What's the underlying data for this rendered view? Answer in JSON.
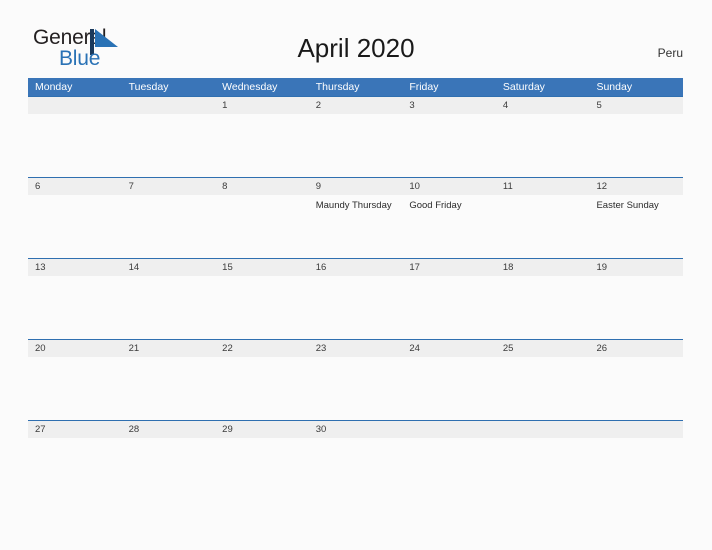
{
  "brand": {
    "name_part1": "General",
    "name_part2": "Blue",
    "mark": "triangle-flag-logo",
    "color_dark": "#231f20",
    "color_blue": "#2a72b5"
  },
  "header": {
    "title": "April 2020",
    "country": "Peru"
  },
  "colors": {
    "header_blue": "#3a75b8",
    "date_band_gray": "#efefef",
    "row_border_blue": "#2f6fb0",
    "page_background": "#fbfbfb"
  },
  "calendar": {
    "weekdays": [
      "Monday",
      "Tuesday",
      "Wednesday",
      "Thursday",
      "Friday",
      "Saturday",
      "Sunday"
    ],
    "weeks": [
      [
        {
          "date": "",
          "event": ""
        },
        {
          "date": "",
          "event": ""
        },
        {
          "date": "1",
          "event": ""
        },
        {
          "date": "2",
          "event": ""
        },
        {
          "date": "3",
          "event": ""
        },
        {
          "date": "4",
          "event": ""
        },
        {
          "date": "5",
          "event": ""
        }
      ],
      [
        {
          "date": "6",
          "event": ""
        },
        {
          "date": "7",
          "event": ""
        },
        {
          "date": "8",
          "event": ""
        },
        {
          "date": "9",
          "event": "Maundy Thursday"
        },
        {
          "date": "10",
          "event": "Good Friday"
        },
        {
          "date": "11",
          "event": ""
        },
        {
          "date": "12",
          "event": "Easter Sunday"
        }
      ],
      [
        {
          "date": "13",
          "event": ""
        },
        {
          "date": "14",
          "event": ""
        },
        {
          "date": "15",
          "event": ""
        },
        {
          "date": "16",
          "event": ""
        },
        {
          "date": "17",
          "event": ""
        },
        {
          "date": "18",
          "event": ""
        },
        {
          "date": "19",
          "event": ""
        }
      ],
      [
        {
          "date": "20",
          "event": ""
        },
        {
          "date": "21",
          "event": ""
        },
        {
          "date": "22",
          "event": ""
        },
        {
          "date": "23",
          "event": ""
        },
        {
          "date": "24",
          "event": ""
        },
        {
          "date": "25",
          "event": ""
        },
        {
          "date": "26",
          "event": ""
        }
      ],
      [
        {
          "date": "27",
          "event": ""
        },
        {
          "date": "28",
          "event": ""
        },
        {
          "date": "29",
          "event": ""
        },
        {
          "date": "30",
          "event": ""
        },
        {
          "date": "",
          "event": ""
        },
        {
          "date": "",
          "event": ""
        },
        {
          "date": "",
          "event": ""
        }
      ]
    ]
  }
}
